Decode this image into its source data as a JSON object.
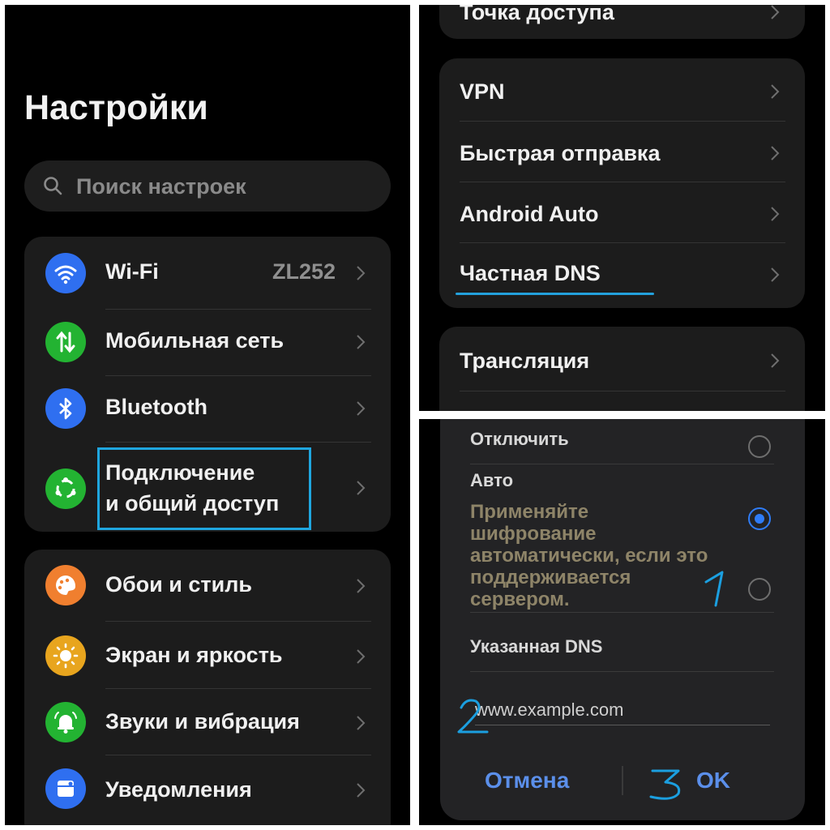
{
  "settings": {
    "title": "Настройки",
    "search_placeholder": "Поиск настроек",
    "group1": [
      {
        "label": "Wi-Fi",
        "value": "ZL252",
        "icon": "wifi-icon",
        "color": "#2f6ff0"
      },
      {
        "label": "Мобильная сеть",
        "value": "",
        "icon": "mobile-data-icon",
        "color": "#23b332"
      },
      {
        "label": "Bluetooth",
        "value": "",
        "icon": "bluetooth-icon",
        "color": "#2f6ff0"
      },
      {
        "label_line1": "Подключение",
        "label_line2": "и общий доступ",
        "icon": "connection-sharing-icon",
        "color": "#23b332"
      }
    ],
    "group2": [
      {
        "label": "Обои и стиль",
        "icon": "palette-icon",
        "color": "#f07f2f"
      },
      {
        "label": "Экран и яркость",
        "icon": "brightness-icon",
        "color": "#e8a51e"
      },
      {
        "label": "Звуки и вибрация",
        "icon": "bell-icon",
        "color": "#23b332"
      },
      {
        "label": "Уведомления",
        "icon": "notifications-icon",
        "color": "#2f6ff0"
      }
    ]
  },
  "connection": {
    "top_item": "Точка доступа",
    "group": [
      "VPN",
      "Быстрая отправка",
      "Android Auto",
      "Частная DNS"
    ],
    "next_item": "Трансляция"
  },
  "private_dns_dialog": {
    "opt_off": "Отключить",
    "opt_auto": "Авто",
    "auto_description": "Применяйте шифрование автоматически, если это поддерживается сервером.",
    "opt_specified": "Указанная DNS",
    "input_value": "www.example.com",
    "cancel_label": "Отмена",
    "ok_label": "OK",
    "selected": "Авто",
    "annotations": [
      "1",
      "2",
      "3"
    ]
  },
  "colors": {
    "accent": "#2f7cf6",
    "highlight": "#1fa6df"
  }
}
